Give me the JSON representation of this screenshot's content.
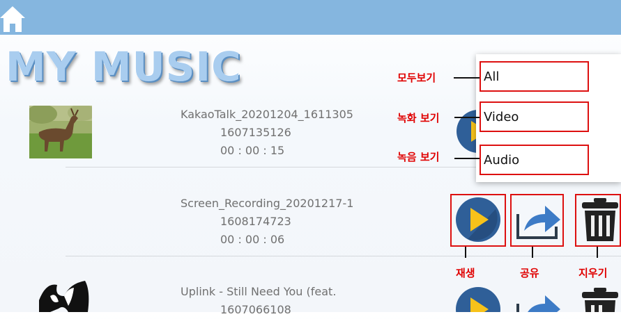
{
  "header": {
    "home_icon": "home-icon",
    "color": "#85b6df"
  },
  "page": {
    "title": "MY MUSIC"
  },
  "tracks": [
    {
      "name": "KakaoTalk_20201204_1611305",
      "id": "1607135126",
      "duration": "00 : 00 : 15",
      "thumb": "deer-photo"
    },
    {
      "name": "Screen_Recording_20201217-1",
      "id": "1608174723",
      "duration": "00 : 00 : 06",
      "thumb": "none"
    },
    {
      "name": "Uplink - Still Need You (feat.",
      "id": "1607066108",
      "duration": "",
      "thumb": "album-art"
    }
  ],
  "filter_menu": {
    "options": [
      "All",
      "Video",
      "Audio"
    ],
    "annotations": [
      "모두보기",
      "녹화 보기",
      "녹음 보기"
    ]
  },
  "actions": {
    "labels": [
      "재생",
      "공유",
      "지우기"
    ],
    "icons": [
      "play-icon",
      "share-icon",
      "trash-icon"
    ]
  },
  "colors": {
    "annotation": "#dd1010",
    "play_bg": "#2f5f98",
    "play_fg": "#f7c21a",
    "share": "#3d7bc6",
    "trash": "#222222"
  }
}
